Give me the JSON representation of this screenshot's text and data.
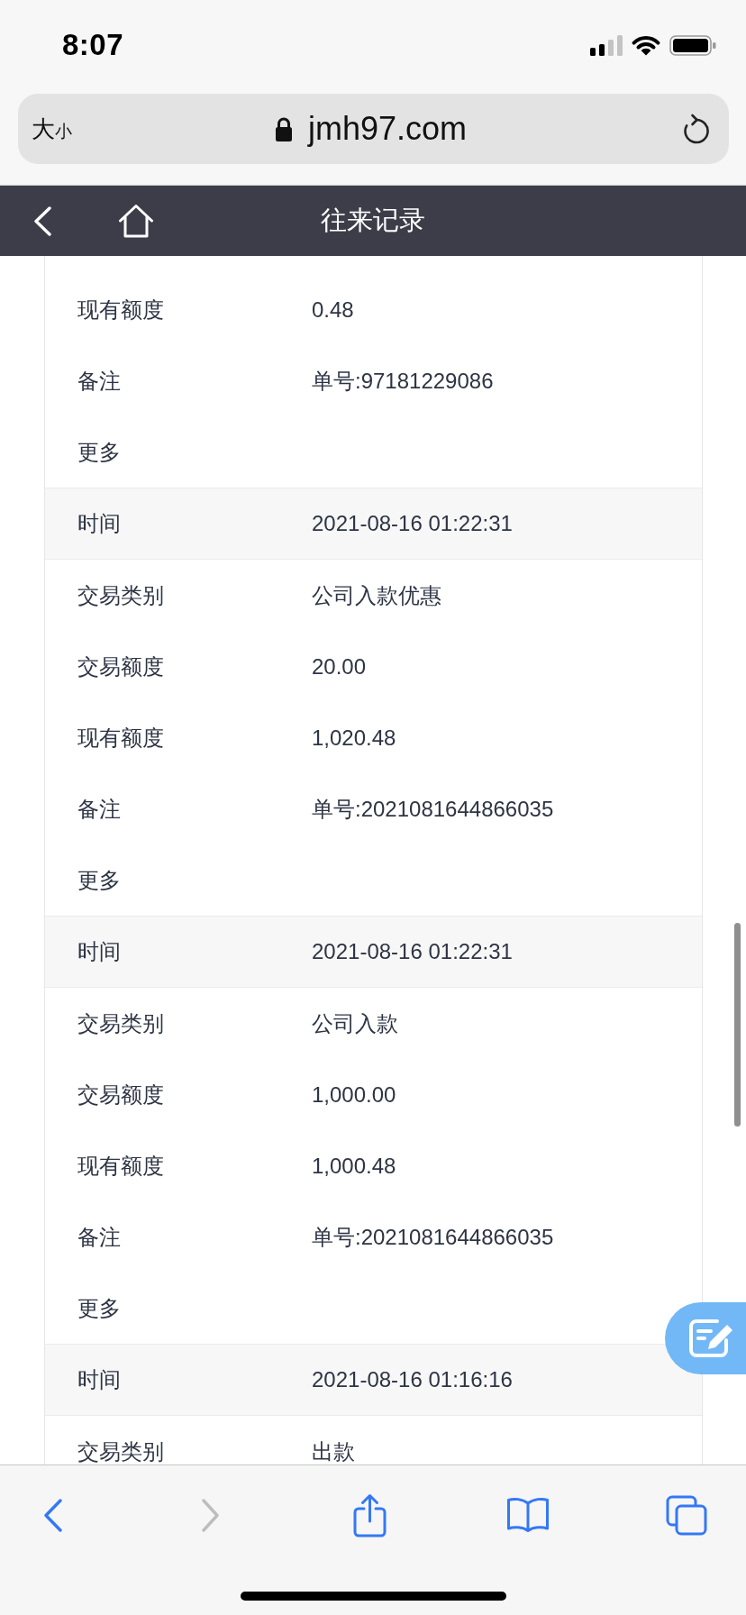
{
  "status_bar": {
    "time": "8:07"
  },
  "address_bar": {
    "text_size": {
      "large": "大",
      "small": "小"
    },
    "url": "jmh97.com"
  },
  "nav_bar": {
    "title": "往来记录"
  },
  "rows": [
    {
      "kind": "field",
      "label": "现有额度",
      "value": "0.48"
    },
    {
      "kind": "field",
      "label": "备注",
      "value": "单号:97181229086"
    },
    {
      "kind": "more",
      "label": "更多"
    },
    {
      "kind": "header",
      "label": "时间",
      "value": "2021-08-16 01:22:31"
    },
    {
      "kind": "field",
      "label": "交易类别",
      "value": "公司入款优惠"
    },
    {
      "kind": "field",
      "label": "交易额度",
      "value": "20.00"
    },
    {
      "kind": "field",
      "label": "现有额度",
      "value": "1,020.48"
    },
    {
      "kind": "field",
      "label": "备注",
      "value": "单号:2021081644866035"
    },
    {
      "kind": "more",
      "label": "更多"
    },
    {
      "kind": "header",
      "label": "时间",
      "value": "2021-08-16 01:22:31"
    },
    {
      "kind": "field",
      "label": "交易类别",
      "value": "公司入款"
    },
    {
      "kind": "field",
      "label": "交易额度",
      "value": "1,000.00"
    },
    {
      "kind": "field",
      "label": "现有额度",
      "value": "1,000.48"
    },
    {
      "kind": "field",
      "label": "备注",
      "value": "单号:2021081644866035"
    },
    {
      "kind": "more",
      "label": "更多"
    },
    {
      "kind": "header",
      "label": "时间",
      "value": "2021-08-16 01:16:16"
    },
    {
      "kind": "field",
      "label": "交易类别",
      "value": "出款"
    }
  ],
  "toolbar": [
    {
      "kind": "back",
      "disabled": false
    },
    {
      "kind": "forward",
      "disabled": true
    },
    {
      "kind": "share",
      "disabled": false
    },
    {
      "kind": "bookmarks",
      "disabled": false
    },
    {
      "kind": "tabs",
      "disabled": false
    }
  ]
}
